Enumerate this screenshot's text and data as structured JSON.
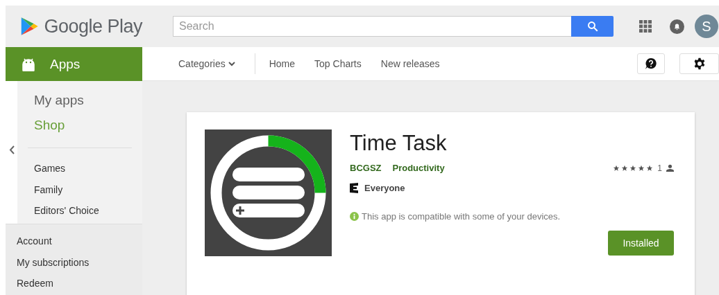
{
  "header": {
    "logo": "Google Play",
    "search": {
      "placeholder": "Search"
    },
    "avatar": "S"
  },
  "sidebar": {
    "section": "Apps",
    "items": [
      {
        "label": "My apps",
        "selected": false
      },
      {
        "label": "Shop",
        "selected": true
      }
    ],
    "categories": [
      "Games",
      "Family",
      "Editors' Choice"
    ],
    "account_links": [
      "Account",
      "My subscriptions",
      "Redeem"
    ]
  },
  "nav": {
    "items": [
      {
        "label": "Categories",
        "kind": "dropdown"
      },
      {
        "label": "Home",
        "kind": "link"
      },
      {
        "label": "Top Charts",
        "kind": "link"
      },
      {
        "label": "New releases",
        "kind": "link"
      }
    ]
  },
  "app": {
    "title": "Time Task",
    "developer": "BCGSZ",
    "category": "Productivity",
    "content_rating": "Everyone",
    "stars": 5,
    "rating_count": "1",
    "compatibility": "This app is compatible with some of your devices.",
    "install_button": "Installed"
  }
}
